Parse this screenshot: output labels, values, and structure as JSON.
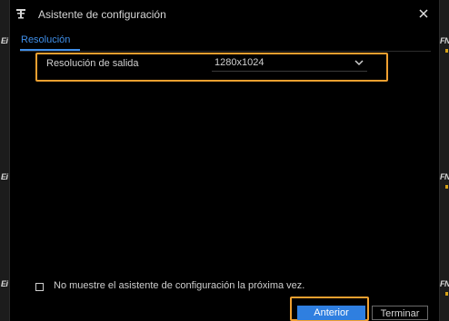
{
  "dialog": {
    "title": "Asistente de configuración",
    "close_icon": "close-icon",
    "title_icon": "wizard-icon"
  },
  "tabs": [
    {
      "label": "Resolución",
      "active": true
    }
  ],
  "settings": {
    "output_resolution": {
      "label": "Resolución de salida",
      "value": "1280x1024"
    }
  },
  "footer": {
    "checkbox_label": "No muestre el asistente de configuración la próxima vez.",
    "checkbox_checked": false,
    "prev_button": "Anterior",
    "finish_button": "Terminar"
  },
  "colors": {
    "accent": "#2f7fe0",
    "highlight": "#f0a030",
    "background": "#000000"
  }
}
